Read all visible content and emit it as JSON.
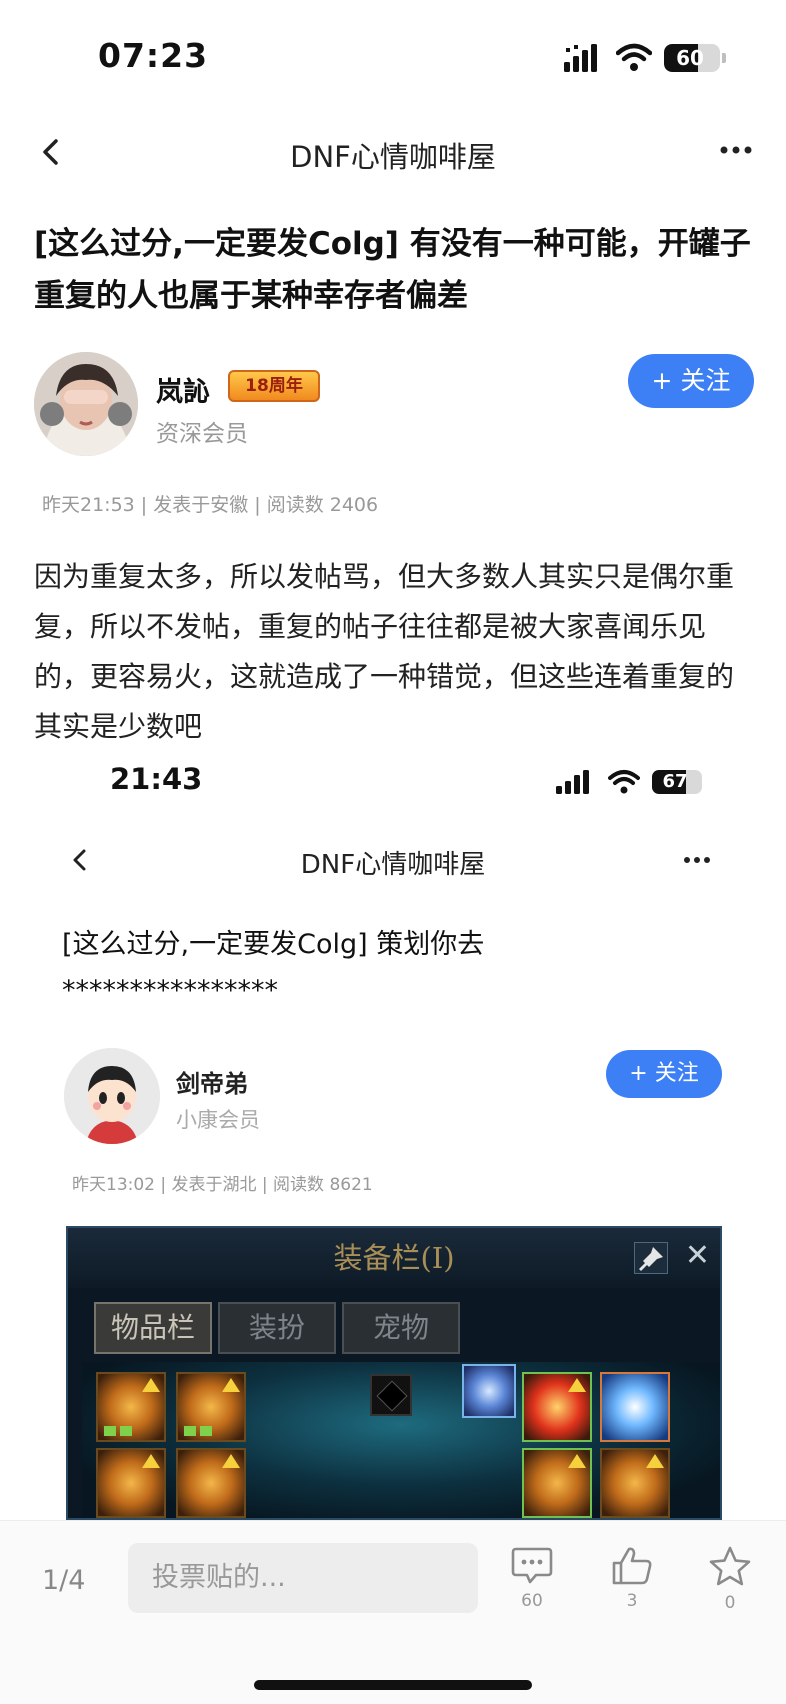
{
  "status_bar": {
    "time": "07:23",
    "battery": "60",
    "battery_level": 0.6
  },
  "nav": {
    "title": "DNF心情咖啡屋"
  },
  "post": {
    "title": "[这么过分,一定要发Colg] 有没有一种可能，开罐子重复的人也属于某种幸存者偏差",
    "author": {
      "name": "岚訫",
      "badge": "18周年",
      "level": "资深会员",
      "follow_label": "+ 关注"
    },
    "meta": "昨天21:53 | 发表于安徽 | 阅读数 2406",
    "body": "因为重复太多，所以发帖骂，但大多数人其实只是偶尔重复，所以不发帖，重复的帖子往往都是被大家喜闻乐见的，更容易火，这就造成了一种错觉，但这些连着重复的其实是少数吧"
  },
  "embedded": {
    "status_bar": {
      "time": "21:43",
      "battery": "67",
      "battery_level": 0.67
    },
    "nav_title": "DNF心情咖啡屋",
    "title_line1": "[这么过分,一定要发Colg] 策划你去",
    "title_line2": "****************",
    "author": {
      "name": "剑帝弟",
      "level": "小康会员",
      "follow_label": "+ 关注"
    },
    "meta": "昨天13:02 | 发表于湖北 | 阅读数 8621",
    "game_window": {
      "title": "装备栏(I)",
      "close": "✕",
      "tabs": [
        "物品栏",
        "装扮",
        "宠物"
      ]
    }
  },
  "bottom_bar": {
    "page_indicator": "1/4",
    "input_placeholder": "投票贴的...",
    "comments": "60",
    "likes": "3",
    "favorites": "0"
  },
  "colors": {
    "accent": "#3d7ff5"
  }
}
